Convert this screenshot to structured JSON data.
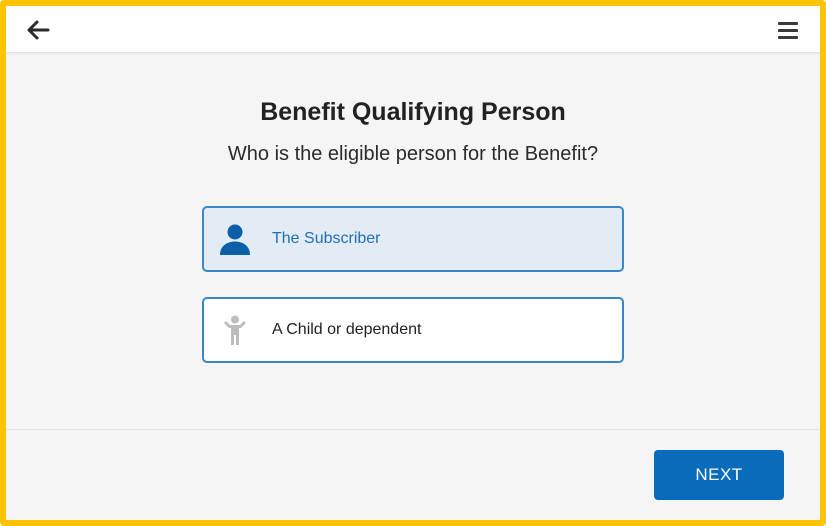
{
  "header": {
    "back_icon": "arrow-left-icon",
    "menu_icon": "hamburger-menu-icon"
  },
  "main": {
    "title": "Benefit Qualifying Person",
    "subtitle": "Who is the eligible person for the Benefit?",
    "options": [
      {
        "label": "The Subscriber",
        "icon": "person-icon",
        "selected": true
      },
      {
        "label": "A Child or dependent",
        "icon": "child-icon",
        "selected": false
      }
    ]
  },
  "footer": {
    "next_label": "NEXT"
  },
  "colors": {
    "frame_border": "#FFC400",
    "accent": "#0a6bbd",
    "option_border": "#3a86c8",
    "selected_bg": "#e3ebf4",
    "selected_text": "#1f6fb5"
  }
}
